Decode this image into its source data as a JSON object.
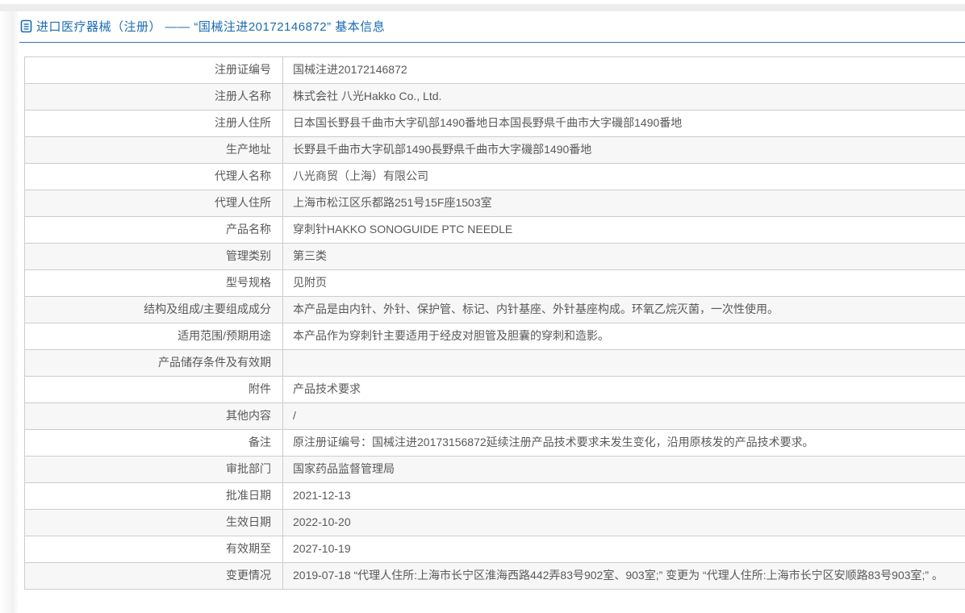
{
  "header": {
    "title": "进口医疗器械（注册） —— “国械注进20172146872” 基本信息",
    "icon": "document-icon"
  },
  "colors": {
    "accent_blue": "#1b6bb1",
    "header_rule": "#3274b5",
    "table_border": "#cccccc",
    "row_alt_bg": "#f7f7f7",
    "text": "#595959",
    "top_band": "#ededed"
  },
  "table": {
    "rows": [
      {
        "label": "注册证编号",
        "value": "国械注进20172146872"
      },
      {
        "label": "注册人名称",
        "value": "株式会社 八光Hakko Co., Ltd."
      },
      {
        "label": "注册人住所",
        "value": "日本国长野县千曲市大字矶部1490番地日本国長野県千曲市大字磯部1490番地"
      },
      {
        "label": "生产地址",
        "value": "长野县千曲市大字矶部1490長野県千曲市大字磯部1490番地"
      },
      {
        "label": "代理人名称",
        "value": "八光商贸（上海）有限公司"
      },
      {
        "label": "代理人住所",
        "value": "上海市松江区乐都路251号15F座1503室"
      },
      {
        "label": "产品名称",
        "value": "穿刺针HAKKO SONOGUIDE PTC NEEDLE"
      },
      {
        "label": "管理类别",
        "value": "第三类"
      },
      {
        "label": "型号规格",
        "value": "见附页"
      },
      {
        "label": "结构及组成/主要组成成分",
        "value": "本产品是由内针、外针、保护管、标记、内针基座、外针基座构成。环氧乙烷灭菌，一次性使用。"
      },
      {
        "label": "适用范围/预期用途",
        "value": "本产品作为穿刺针主要适用于经皮对胆管及胆囊的穿刺和造影。"
      },
      {
        "label": "产品储存条件及有效期",
        "value": ""
      },
      {
        "label": "附件",
        "value": "产品技术要求"
      },
      {
        "label": "其他内容",
        "value": "/"
      },
      {
        "label": "备注",
        "value": "原注册证编号：国械注进20173156872延续注册产品技术要求未发生变化，沿用原核发的产品技术要求。"
      },
      {
        "label": "审批部门",
        "value": "国家药品监督管理局"
      },
      {
        "label": "批准日期",
        "value": "2021-12-13"
      },
      {
        "label": "生效日期",
        "value": "2022-10-20"
      },
      {
        "label": "有效期至",
        "value": "2027-10-19"
      },
      {
        "label": "变更情况",
        "value": "2019-07-18 “代理人住所:上海市长宁区淮海西路442弄83号902室、903室;” 变更为 “代理人住所:上海市长宁区安顺路83号903室;” 。"
      }
    ]
  }
}
